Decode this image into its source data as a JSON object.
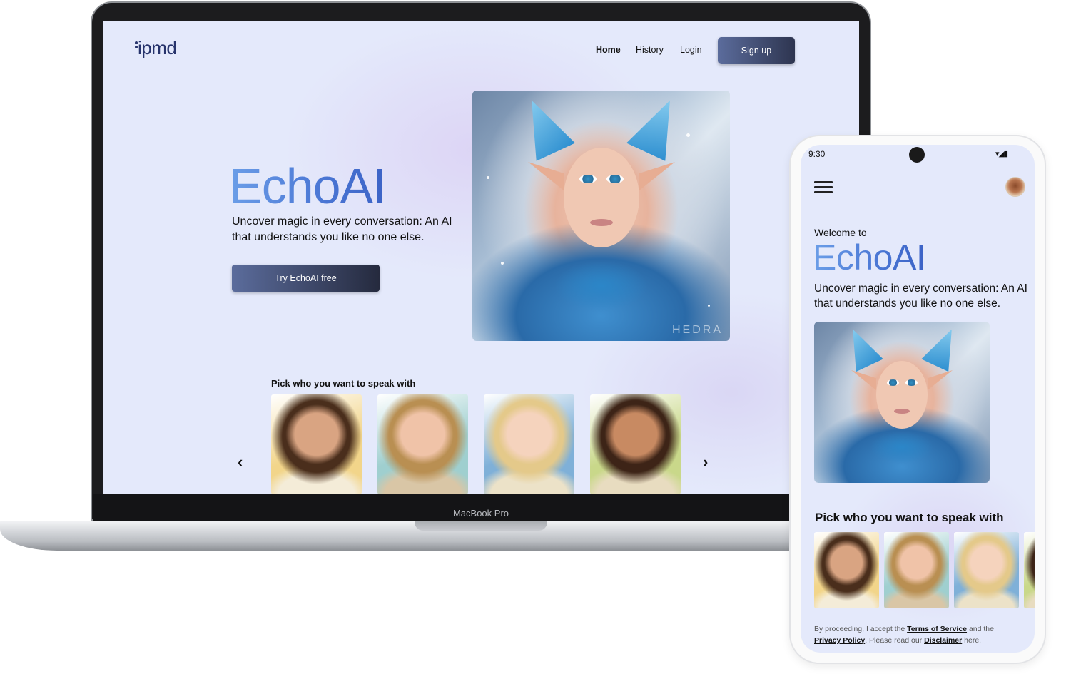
{
  "desktop": {
    "logo": "ipmd",
    "nav": {
      "home": "Home",
      "history": "History",
      "login": "Login",
      "signup": "Sign up"
    },
    "hero": {
      "title": "EchoAI",
      "subtitle": "Uncover magic in every conversation: An AI that understands you like no one else.",
      "cta": "Try EchoAI free",
      "image_watermark": "HEDRA"
    },
    "picker": {
      "title": "Pick who you want to speak with",
      "characters": [
        {
          "name": "angel-man",
          "hair": "#4a2e1c",
          "skin": "#d9a482",
          "bg": "#f2d58a",
          "outfit": "#f4ecd8"
        },
        {
          "name": "blonde-woman",
          "hair": "#b98f52",
          "skin": "#f0c3a8",
          "bg": "#9fcfcf",
          "outfit": "#d9c6a6"
        },
        {
          "name": "angel-woman",
          "hair": "#e4c98a",
          "skin": "#f5d3bd",
          "bg": "#7fb0d8",
          "outfit": "#ece2c8"
        },
        {
          "name": "brunette-girl",
          "hair": "#3d2417",
          "skin": "#c88a62",
          "bg": "#c9d88a",
          "outfit": "#e8dcc0"
        }
      ],
      "prev_icon": "chevron-left-icon",
      "next_icon": "chevron-right-icon"
    },
    "device_label": "MacBook Pro"
  },
  "mobile": {
    "time": "9:30",
    "status_icons": "▾◢▮",
    "menu_icon": "hamburger-menu-icon",
    "welcome": "Welcome to",
    "title": "EchoAI",
    "subtitle": "Uncover magic in every conversation: An AI that understands you like no one else.",
    "picker_title": "Pick who you want to speak with",
    "legal": {
      "prefix": "By proceeding, I accept the ",
      "terms": "Terms of Service",
      "middle": " and the ",
      "privacy": "Privacy Policy",
      "read": ". Please read our ",
      "disclaimer": "Disclaimer",
      "suffix": " here."
    }
  },
  "colors": {
    "background": "#e4e9fb",
    "accent_gradient_start": "#6b9ee8",
    "accent_gradient_end": "#3c63c6",
    "button_dark": "#2e3550",
    "logo": "#27346c"
  }
}
